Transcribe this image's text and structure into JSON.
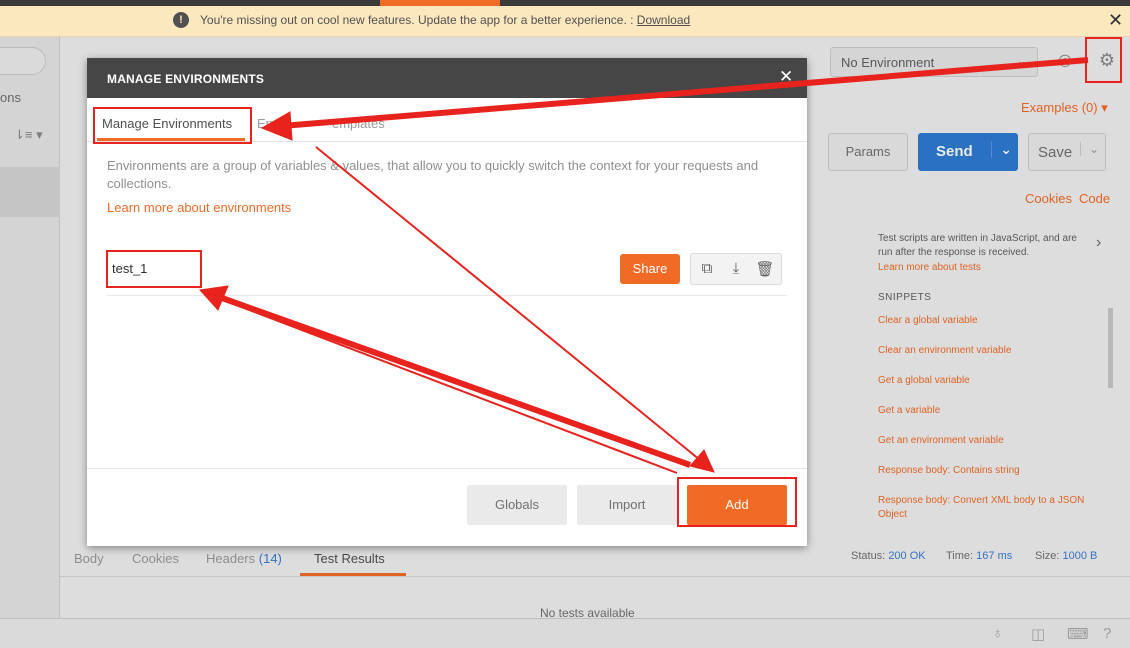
{
  "banner": {
    "warning_icon": "!",
    "message": "You're missing out on cool new features. Update the app for a better experience. :",
    "download_link": "Download",
    "close": "✕"
  },
  "left": {
    "partial_label": "ons",
    "sort_icon": "sort-icon"
  },
  "toolbar": {
    "environment": "No Environment",
    "examples": "Examples (0)",
    "params": "Params",
    "send": "Send",
    "save": "Save",
    "cookies": "Cookies",
    "code": "Code"
  },
  "tests_panel": {
    "description": "Test scripts are written in JavaScript, and are run after the response is received.",
    "learn_more": "Learn more about tests",
    "snippets_heading": "SNIPPETS",
    "snippets": [
      "Clear a global variable",
      "Clear an environment variable",
      "Get a global variable",
      "Get a variable",
      "Get an environment variable",
      "Response body: Contains string",
      "Response body: Convert XML body to a JSON Object"
    ]
  },
  "response": {
    "tabs": [
      {
        "label": "Body"
      },
      {
        "label": "Cookies"
      },
      {
        "label": "Headers",
        "count": "(14)"
      },
      {
        "label": "Test Results"
      }
    ],
    "status_label": "Status:",
    "status_value": "200 OK",
    "time_label": "Time:",
    "time_value": "167 ms",
    "size_label": "Size:",
    "size_value": "1000 B",
    "empty": "No tests available"
  },
  "modal": {
    "title": "MANAGE ENVIRONMENTS",
    "close": "✕",
    "tabs": [
      "Manage Environments",
      "Envir",
      "emplates"
    ],
    "description": "Environments are a group of variables & values, that allow you to quickly switch the context for your requests and collections.",
    "learn_more": "Learn more about environments",
    "environments": [
      {
        "name": "test_1",
        "share": "Share"
      }
    ],
    "buttons": {
      "globals": "Globals",
      "import": "Import",
      "add": "Add"
    }
  },
  "colors": {
    "accent": "#f26b26",
    "annotation": "#e8231e",
    "send": "#2f7bd3",
    "modal_header": "#464646"
  }
}
